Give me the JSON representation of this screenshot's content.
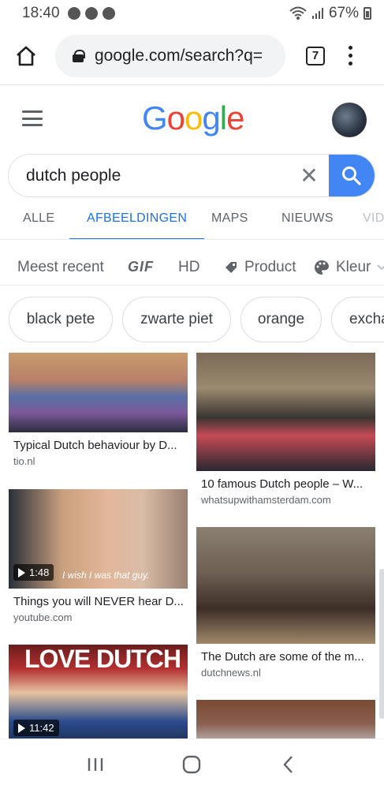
{
  "status": {
    "time": "18:40",
    "battery": "67%"
  },
  "browser": {
    "url": "google.com/search?q=",
    "tab_count": "7"
  },
  "search": {
    "query": "dutch people"
  },
  "tabs": [
    {
      "label": "ALLE"
    },
    {
      "label": "AFBEELDINGEN"
    },
    {
      "label": "MAPS"
    },
    {
      "label": "NIEUWS"
    },
    {
      "label": "VID"
    }
  ],
  "filters": {
    "recent": "Meest recent",
    "gif": "GIF",
    "hd": "HD",
    "product": "Product",
    "color": "Kleur"
  },
  "chips": [
    {
      "label": "black pete"
    },
    {
      "label": "zwarte piet"
    },
    {
      "label": "orange"
    },
    {
      "label": "excha"
    }
  ],
  "results": [
    {
      "title": "Typical Dutch behaviour by D...",
      "source": "tio.nl"
    },
    {
      "title": "10 famous Dutch people – W...",
      "source": "whatsupwithamsterdam.com"
    },
    {
      "title": "Things you will NEVER hear D...",
      "source": "youtube.com",
      "duration": "1:48",
      "caption": "I wish I was that guy."
    },
    {
      "title": "The Dutch are some of the m...",
      "source": "dutchnews.nl"
    },
    {
      "duration": "11:42",
      "overlay": "LOVE DUTCH"
    }
  ],
  "colors": {
    "accent": "#1a73e8",
    "search_button": "#4285f4"
  }
}
